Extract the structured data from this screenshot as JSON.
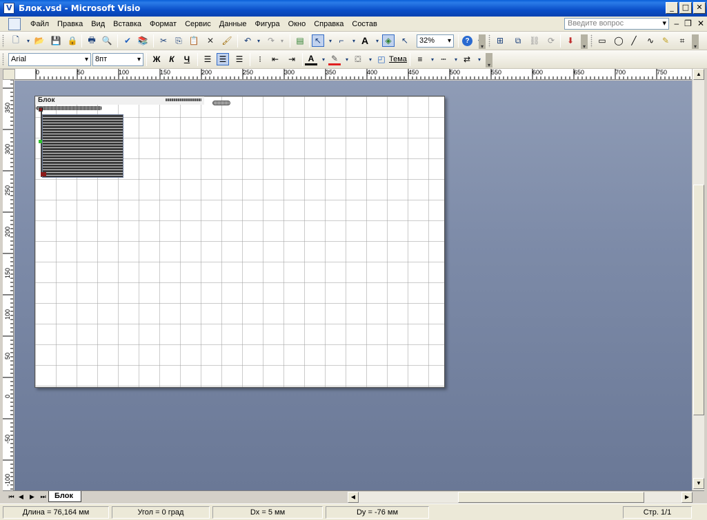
{
  "window": {
    "title": "Блок.vsd - Microsoft Visio",
    "min_label": "_",
    "max_label": "□",
    "close_label": "✕"
  },
  "menu": {
    "items": [
      "Файл",
      "Правка",
      "Вид",
      "Вставка",
      "Формат",
      "Сервис",
      "Данные",
      "Фигура",
      "Окно",
      "Справка",
      "Состав"
    ],
    "help_placeholder": "Введите вопрос",
    "doc_min": "–",
    "doc_restore": "❐",
    "doc_close": "✕"
  },
  "toolbar_standard": {
    "zoom": "32%",
    "text_tool": "A"
  },
  "toolbar_format": {
    "font": "Arial",
    "size": "8пт",
    "bold": "Ж",
    "italic": "К",
    "underline": "Ч",
    "font_color_label": "A",
    "theme_label": "Тема"
  },
  "ruler": {
    "h_ticks": [
      "0",
      "50",
      "100",
      "150",
      "200",
      "250",
      "300",
      "350",
      "400",
      "450",
      "500",
      "550",
      "600",
      "650",
      "700",
      "750"
    ],
    "v_ticks": [
      "350",
      "300",
      "250",
      "200",
      "150",
      "100",
      "50",
      "0",
      "-50",
      "-100"
    ]
  },
  "page": {
    "title": "Блок"
  },
  "tabs": {
    "page_tab": "Блок"
  },
  "status": {
    "length": "Длина = 76,164 мм",
    "angle": "Угол = 0 град",
    "dx": "Dx = 5 мм",
    "dy": "Dy = -76 мм",
    "page": "Стр. 1/1"
  }
}
